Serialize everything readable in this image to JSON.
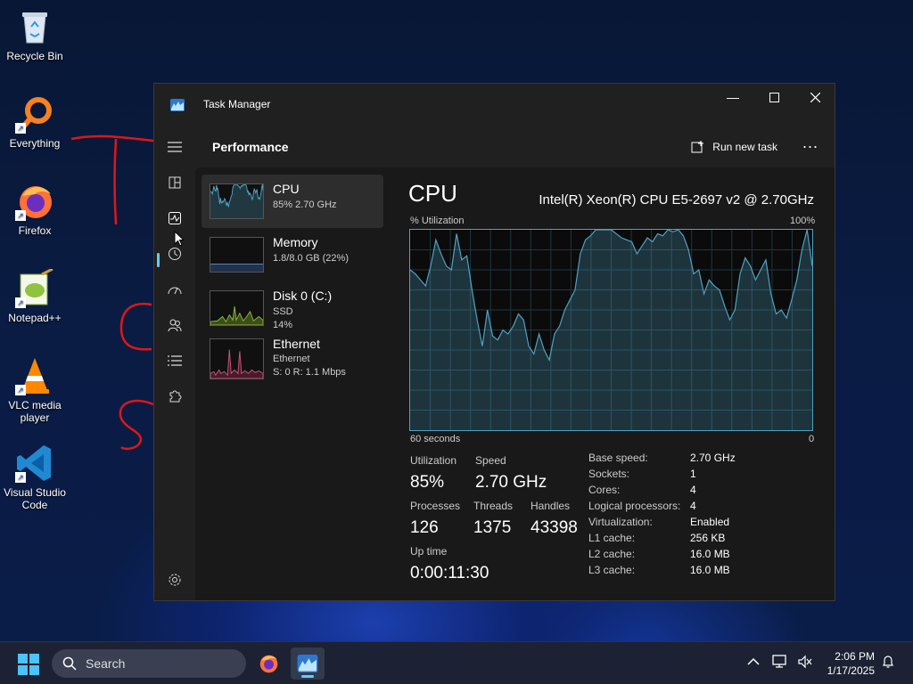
{
  "desktop": {
    "icons": [
      {
        "label": "Recycle Bin"
      },
      {
        "label": "Everything"
      },
      {
        "label": "Firefox"
      },
      {
        "label": "Notepad++"
      },
      {
        "label": "VLC media player"
      },
      {
        "label": "Visual Studio Code"
      }
    ]
  },
  "window": {
    "title": "Task Manager",
    "page_title": "Performance",
    "run_new_task": "Run new task",
    "more": "..."
  },
  "perf_list": [
    {
      "name": "CPU",
      "sub1": "85%  2.70 GHz",
      "sub2": "",
      "sub3": ""
    },
    {
      "name": "Memory",
      "sub1": "1.8/8.0 GB (22%)",
      "sub2": "",
      "sub3": ""
    },
    {
      "name": "Disk 0 (C:)",
      "sub1": "SSD",
      "sub2": "14%",
      "sub3": ""
    },
    {
      "name": "Ethernet",
      "sub1": "Ethernet",
      "sub2": "S: 0  R: 1.1 Mbps",
      "sub3": ""
    }
  ],
  "cpu_detail": {
    "title": "CPU",
    "model": "Intel(R) Xeon(R) CPU E5-2697 v2 @ 2.70GHz",
    "graph_label": "% Utilization",
    "graph_max": "100%",
    "graph_span": "60 seconds",
    "graph_min": "0",
    "utilization_label": "Utilization",
    "utilization": "85%",
    "speed_label": "Speed",
    "speed": "2.70 GHz",
    "processes_label": "Processes",
    "processes": "126",
    "threads_label": "Threads",
    "threads": "1375",
    "handles_label": "Handles",
    "handles": "43398",
    "uptime_label": "Up time",
    "uptime": "0:00:11:30",
    "specs": [
      {
        "k": "Base speed:",
        "v": "2.70 GHz"
      },
      {
        "k": "Sockets:",
        "v": "1"
      },
      {
        "k": "Cores:",
        "v": "4"
      },
      {
        "k": "Logical processors:",
        "v": "4"
      },
      {
        "k": "Virtualization:",
        "v": "Enabled"
      },
      {
        "k": "L1 cache:",
        "v": "256 KB"
      },
      {
        "k": "L2 cache:",
        "v": "16.0 MB"
      },
      {
        "k": "L3 cache:",
        "v": "16.0 MB"
      }
    ]
  },
  "cpu_history": [
    80,
    78,
    75,
    72,
    82,
    95,
    88,
    82,
    80,
    98,
    85,
    87,
    70,
    55,
    42,
    60,
    47,
    45,
    50,
    48,
    52,
    58,
    55,
    42,
    38,
    48,
    40,
    35,
    48,
    52,
    60,
    65,
    70,
    88,
    95,
    97,
    100,
    100,
    100,
    100,
    98,
    96,
    95,
    94,
    88,
    92,
    96,
    94,
    98,
    97,
    100,
    99,
    100,
    97,
    90,
    78,
    80,
    68,
    75,
    72,
    70,
    62,
    55,
    60,
    78,
    86,
    82,
    75,
    80,
    85,
    68,
    58,
    60,
    56,
    65,
    75,
    90,
    100,
    82
  ],
  "taskbar": {
    "search_placeholder": "Search",
    "time": "2:06 PM",
    "date": "1/17/2025"
  },
  "colors": {
    "accent": "#60cdff",
    "cpu_line": "#4fa2c2",
    "memory_line": "#5b8fd6",
    "disk_line": "#8cb43c",
    "ethernet_line": "#c8567a"
  }
}
